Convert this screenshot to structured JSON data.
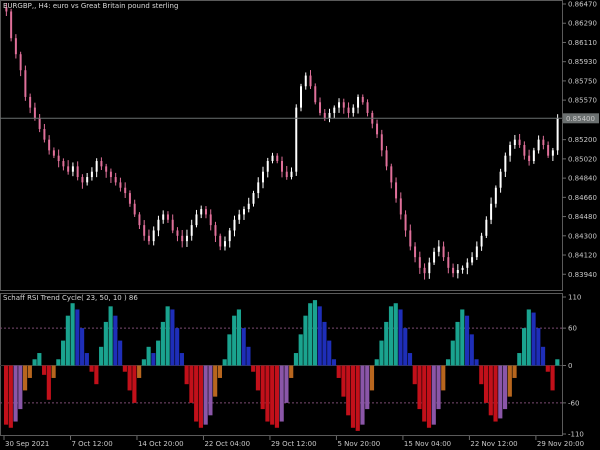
{
  "header": {
    "main_title": "EURGBP,, H4:  euro vs Great Britain pound sterling",
    "indicator_title": "Schaff RSI Trend Cycle( 23, 50, 10 ) 86"
  },
  "colors": {
    "background": "#000000",
    "bull_candle": "#ffffff",
    "bear_candle": "#e0709a",
    "current_price_line": "#6b7070",
    "current_price_tag_bg": "#6b7070",
    "hist_teal": "#1aa38f",
    "hist_blue": "#1e2eb8",
    "hist_red": "#c2101a",
    "hist_orange": "#b8661e",
    "hist_purple": "#8a56a8",
    "level_line": "#7a4a72",
    "frame": "#5a5a5a"
  },
  "icons": {
    "chart_canvas": "candlestick-chart"
  },
  "chart_data": [
    {
      "type": "candlestick",
      "title": "EURGBP,, H4:  euro vs Great Britain pound sterling",
      "ylim": [
        0.8383,
        0.8647
      ],
      "y_ticks": [
        "0.86470",
        "0.86290",
        "0.86110",
        "0.85930",
        "0.85750",
        "0.85570",
        "0.85380",
        "0.85200",
        "0.85020",
        "0.84840",
        "0.84660",
        "0.84480",
        "0.84300",
        "0.84120",
        "0.83940"
      ],
      "current_price": 0.854,
      "current_price_label": "0.85400",
      "x_ticks": [
        "30 Sep 2021",
        "7 Oct 12:00",
        "14 Oct 20:00",
        "22 Oct 04:00",
        "29 Oct 12:00",
        "5 Nov 20:00",
        "15 Nov 04:00",
        "22 Nov 12:00",
        "29 Nov 20:00"
      ],
      "series": [
        {
          "values": [
            0.864,
            0.8615,
            0.86,
            0.8585,
            0.856,
            0.855,
            0.854,
            0.853,
            0.852,
            0.851,
            0.8505,
            0.85,
            0.8495,
            0.849,
            0.8495,
            0.8485,
            0.848,
            0.8485,
            0.849,
            0.85,
            0.8495,
            0.849,
            0.8485,
            0.848,
            0.8475,
            0.847,
            0.846,
            0.845,
            0.844,
            0.843,
            0.8425,
            0.8435,
            0.8445,
            0.845,
            0.8445,
            0.8435,
            0.843,
            0.8425,
            0.843,
            0.844,
            0.845,
            0.8455,
            0.845,
            0.844,
            0.843,
            0.842,
            0.8425,
            0.8435,
            0.8445,
            0.845,
            0.8455,
            0.846,
            0.847,
            0.848,
            0.849,
            0.85,
            0.8505,
            0.85,
            0.849,
            0.8485,
            0.849,
            0.855,
            0.857,
            0.858,
            0.857,
            0.8555,
            0.8545,
            0.854,
            0.8545,
            0.855,
            0.8555,
            0.855,
            0.8545,
            0.855,
            0.856,
            0.8555,
            0.8545,
            0.8535,
            0.8525,
            0.851,
            0.8495,
            0.848,
            0.8465,
            0.845,
            0.8435,
            0.842,
            0.841,
            0.84,
            0.8395,
            0.8405,
            0.8415,
            0.842,
            0.841,
            0.84,
            0.8395,
            0.8398,
            0.84,
            0.8405,
            0.841,
            0.842,
            0.843,
            0.8445,
            0.846,
            0.8475,
            0.849,
            0.8505,
            0.8515,
            0.852,
            0.8515,
            0.8505,
            0.85,
            0.851,
            0.852,
            0.8515,
            0.8505,
            0.851,
            0.854
          ]
        }
      ]
    },
    {
      "type": "bar",
      "title": "Schaff RSI Trend Cycle( 23, 50, 10 ) 86",
      "ylim": [
        -110,
        110
      ],
      "y_ticks": [
        "110",
        "60",
        "0",
        "-60",
        "-110"
      ],
      "levels": [
        60,
        -60
      ],
      "series": [
        {
          "values": [
            -95,
            -100,
            -90,
            -70,
            -40,
            -20,
            10,
            20,
            -15,
            -55,
            -20,
            10,
            40,
            80,
            100,
            90,
            60,
            20,
            -10,
            -30,
            30,
            70,
            95,
            80,
            40,
            -10,
            -40,
            -60,
            -20,
            10,
            30,
            20,
            40,
            70,
            95,
            90,
            60,
            20,
            -30,
            -60,
            -90,
            -100,
            -95,
            -80,
            -50,
            -20,
            10,
            50,
            80,
            90,
            60,
            30,
            -10,
            -40,
            -70,
            -90,
            -95,
            -100,
            -90,
            -60,
            -20,
            20,
            50,
            80,
            100,
            105,
            95,
            70,
            40,
            10,
            -20,
            -50,
            -80,
            -100,
            -105,
            -95,
            -70,
            -40,
            10,
            40,
            70,
            95,
            100,
            90,
            60,
            20,
            -30,
            -70,
            -90,
            -100,
            -95,
            -70,
            -40,
            10,
            40,
            70,
            90,
            80,
            50,
            10,
            -30,
            -60,
            -80,
            -90,
            -85,
            -70,
            -50,
            -20,
            20,
            60,
            90,
            85,
            60,
            30,
            -10,
            -40,
            10
          ]
        }
      ]
    }
  ]
}
